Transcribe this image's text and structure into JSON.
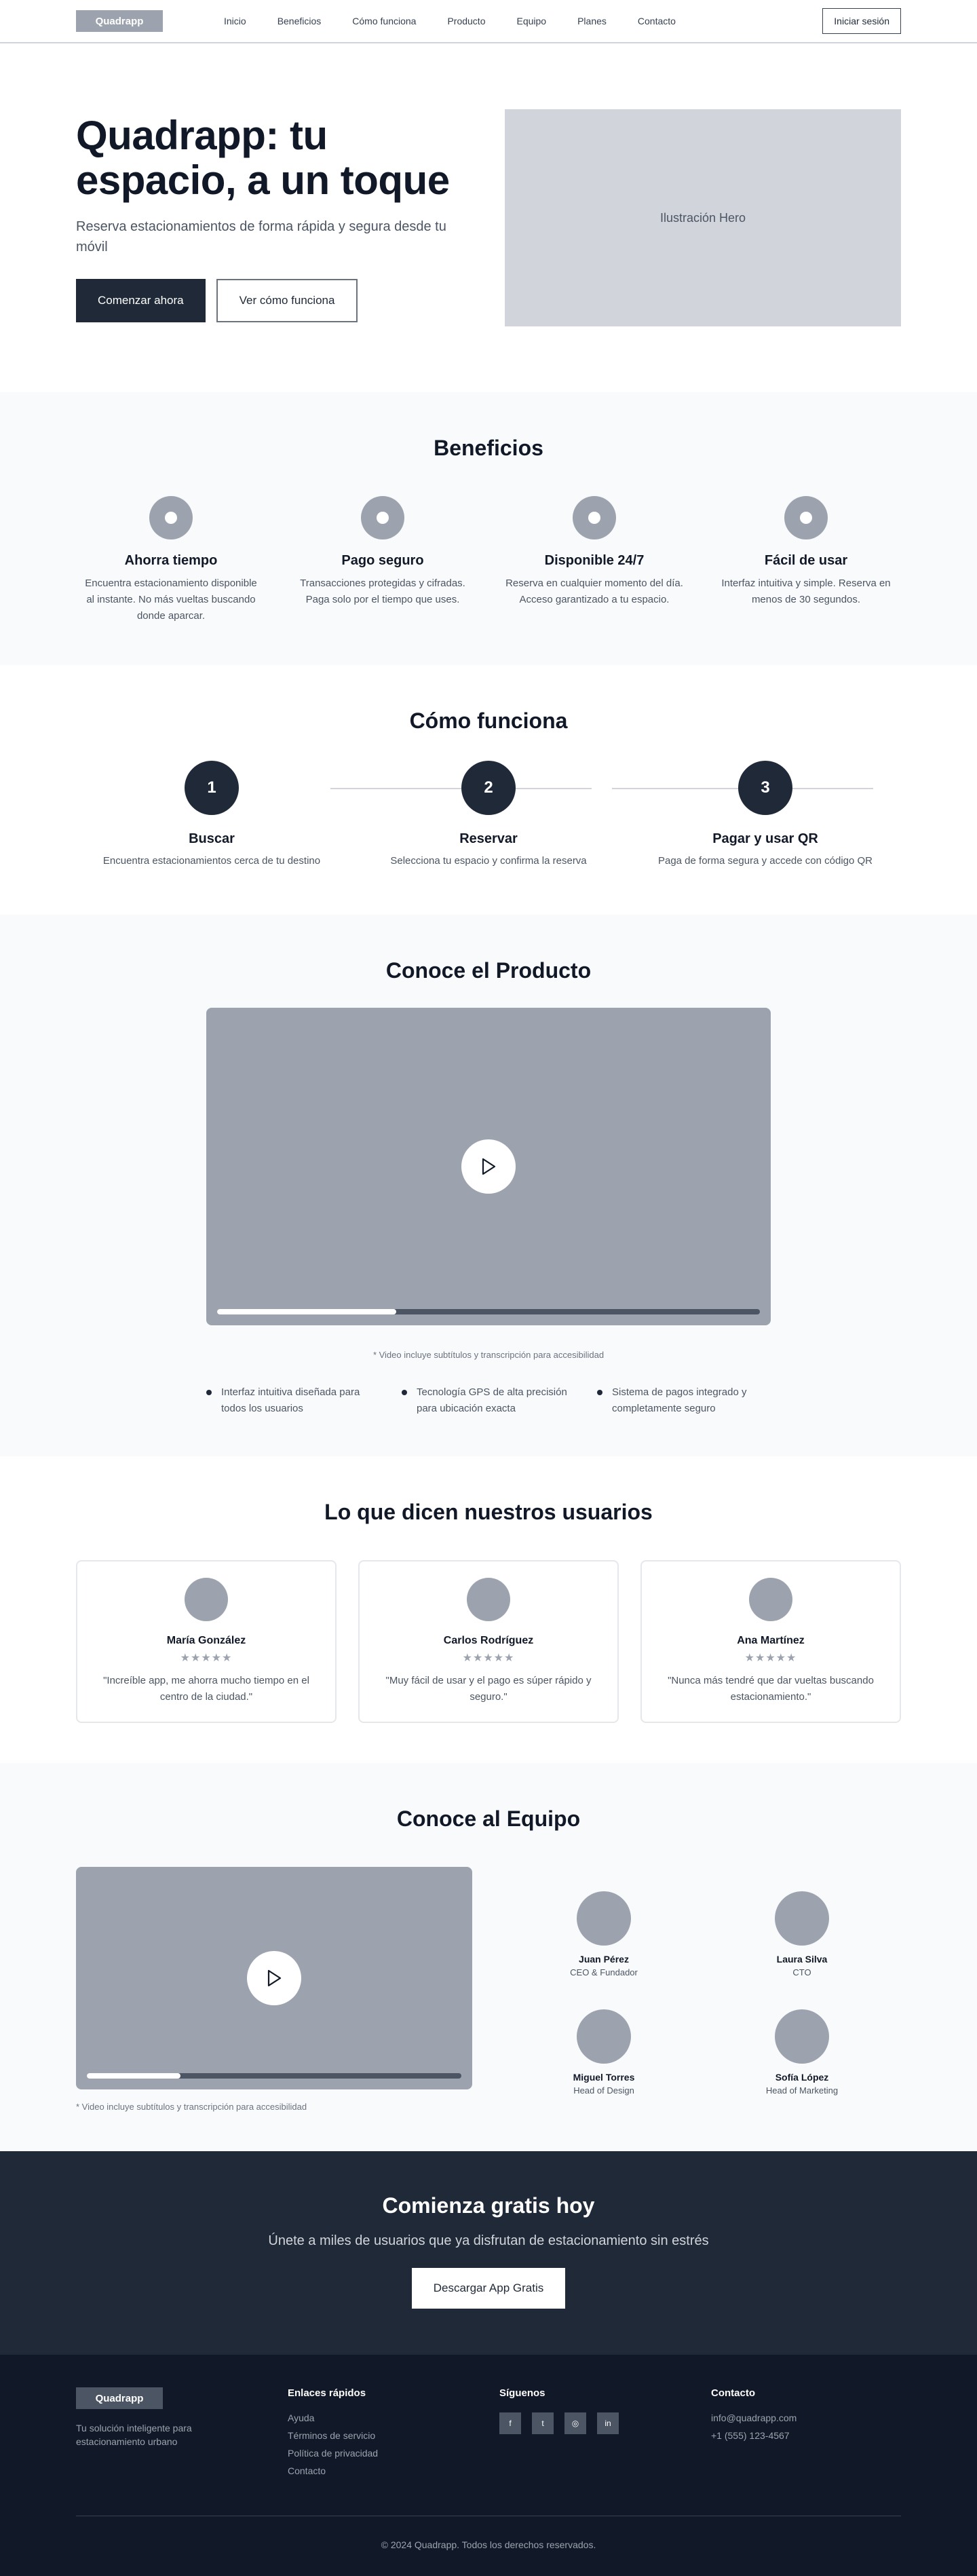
{
  "nav": {
    "logo": "Quadrapp",
    "links": [
      "Inicio",
      "Beneficios",
      "Cómo funciona",
      "Producto",
      "Equipo",
      "Planes",
      "Contacto"
    ],
    "login": "Iniciar sesión"
  },
  "hero": {
    "title": "Quadrapp: tu espacio, a un toque",
    "subtitle": "Reserva estacionamientos de forma rápida y segura desde tu móvil",
    "primary": "Comenzar ahora",
    "secondary": "Ver cómo funciona",
    "image_label": "Ilustración Hero"
  },
  "benefits": {
    "title": "Beneficios",
    "items": [
      {
        "title": "Ahorra tiempo",
        "text": "Encuentra estacionamiento disponible al instante. No más vueltas buscando donde aparcar."
      },
      {
        "title": "Pago seguro",
        "text": "Transacciones protegidas y cifradas. Paga solo por el tiempo que uses."
      },
      {
        "title": "Disponible 24/7",
        "text": "Reserva en cualquier momento del día. Acceso garantizado a tu espacio."
      },
      {
        "title": "Fácil de usar",
        "text": "Interfaz intuitiva y simple. Reserva en menos de 30 segundos."
      }
    ]
  },
  "how": {
    "title": "Cómo funciona",
    "steps": [
      {
        "num": "1",
        "title": "Buscar",
        "text": "Encuentra estacionamientos cerca de tu destino"
      },
      {
        "num": "2",
        "title": "Reservar",
        "text": "Selecciona tu espacio y confirma la reserva"
      },
      {
        "num": "3",
        "title": "Pagar y usar QR",
        "text": "Paga de forma segura y accede con código QR"
      }
    ]
  },
  "product": {
    "title": "Conoce el Producto",
    "progress": 0.33,
    "note": "* Video incluye subtítulos y transcripción para accesibilidad",
    "features": [
      "Interfaz intuitiva diseñada para todos los usuarios",
      "Tecnología GPS de alta precisión para ubicación exacta",
      "Sistema de pagos integrado y completamente seguro"
    ]
  },
  "testimonials": {
    "title": "Lo que dicen nuestros usuarios",
    "items": [
      {
        "name": "María González",
        "stars": "★★★★★",
        "text": "\"Increíble app, me ahorra mucho tiempo en el centro de la ciudad.\""
      },
      {
        "name": "Carlos Rodríguez",
        "stars": "★★★★★",
        "text": "\"Muy fácil de usar y el pago es súper rápido y seguro.\""
      },
      {
        "name": "Ana Martínez",
        "stars": "★★★★★",
        "text": "\"Nunca más tendré que dar vueltas buscando estacionamiento.\""
      }
    ]
  },
  "team": {
    "title": "Conoce al Equipo",
    "progress": 0.25,
    "note": "* Video incluye subtítulos y transcripción para accesibilidad",
    "members": [
      {
        "name": "Juan Pérez",
        "role": "CEO & Fundador"
      },
      {
        "name": "Laura Silva",
        "role": "CTO"
      },
      {
        "name": "Miguel Torres",
        "role": "Head of Design"
      },
      {
        "name": "Sofía López",
        "role": "Head of Marketing"
      }
    ]
  },
  "cta": {
    "title": "Comienza gratis hoy",
    "subtitle": "Únete a miles de usuarios que ya disfrutan de estacionamiento sin estrés",
    "button": "Descargar App Gratis"
  },
  "footer": {
    "logo": "Quadrapp",
    "description": "Tu solución inteligente para estacionamiento urbano",
    "links_title": "Enlaces rápidos",
    "links": [
      "Ayuda",
      "Términos de servicio",
      "Política de privacidad",
      "Contacto"
    ],
    "social_title": "Síguenos",
    "socials": [
      {
        "icon": "facebook-icon",
        "glyph": "f"
      },
      {
        "icon": "twitter-icon",
        "glyph": "t"
      },
      {
        "icon": "instagram-icon",
        "glyph": "◎"
      },
      {
        "icon": "linkedin-icon",
        "glyph": "in"
      }
    ],
    "contact_title": "Contacto",
    "email": "info@quadrapp.com",
    "phone": "+1 (555) 123-4567",
    "copyright": "© 2024 Quadrapp. Todos los derechos reservados."
  }
}
